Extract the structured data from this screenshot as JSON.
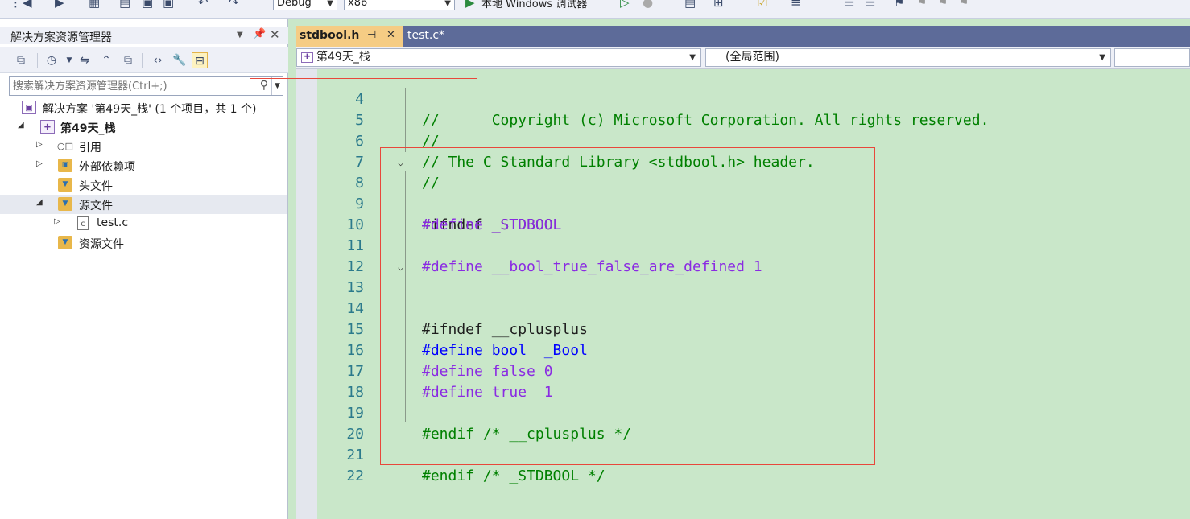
{
  "toolbar": {
    "config": "Debug",
    "platform": "x86",
    "debugger_label": "本地 Windows 调试器"
  },
  "solution_explorer": {
    "title": "解决方案资源管理器",
    "search_placeholder": "搜索解决方案资源管理器(Ctrl+;)",
    "tree": [
      {
        "label": "解决方案 '第49天_栈' (1 个项目，共 1 个)",
        "icon": "solution-icon",
        "level": 0,
        "arrow": ""
      },
      {
        "label": "第49天_栈",
        "icon": "project-icon",
        "level": 1,
        "arrow": "◢",
        "bold": true
      },
      {
        "label": "引用",
        "icon": "references-icon",
        "level": 2,
        "arrow": "▷"
      },
      {
        "label": "外部依赖项",
        "icon": "external-deps-icon",
        "level": 2,
        "arrow": "▷"
      },
      {
        "label": "头文件",
        "icon": "folder-filter-icon",
        "level": 2,
        "arrow": ""
      },
      {
        "label": "源文件",
        "icon": "folder-filter-icon",
        "level": 2,
        "arrow": "◢",
        "selected": true
      },
      {
        "label": "test.c",
        "icon": "c-file-icon",
        "level": 3,
        "arrow": "▷"
      },
      {
        "label": "资源文件",
        "icon": "folder-filter-icon",
        "level": 2,
        "arrow": ""
      }
    ]
  },
  "editor": {
    "tabs": [
      {
        "label": "stdbool.h",
        "active": true
      },
      {
        "label": "test.c*",
        "active": false
      }
    ],
    "nav_project": "第49天_栈",
    "nav_scope": "(全局范围)",
    "lines": [
      {
        "n": "4",
        "text": "//      Copyright (c) Microsoft Corporation. All rights reserved."
      },
      {
        "n": "5",
        "text": "//"
      },
      {
        "n": "6",
        "text": "// The C Standard Library <stdbool.h> header."
      },
      {
        "n": "7",
        "text": "//"
      },
      {
        "n": "8",
        "text": "#ifndef _STDBOOL"
      },
      {
        "n": "9",
        "text": "#define _STDBOOL"
      },
      {
        "n": "10",
        "text": ""
      },
      {
        "n": "11",
        "text": "#define __bool_true_false_are_defined 1"
      },
      {
        "n": "12",
        "text": ""
      },
      {
        "n": "13",
        "text": "#ifndef __cplusplus"
      },
      {
        "n": "14",
        "text": ""
      },
      {
        "n": "15",
        "text": "#define bool  _Bool"
      },
      {
        "n": "16",
        "text": "#define false 0"
      },
      {
        "n": "17",
        "text": "#define true  1"
      },
      {
        "n": "18",
        "text": ""
      },
      {
        "n": "19",
        "text": "#endif /* __cplusplus */"
      },
      {
        "n": "20",
        "text": ""
      },
      {
        "n": "21",
        "text": "#endif /* _STDBOOL */"
      },
      {
        "n": "22",
        "text": ""
      }
    ]
  },
  "colors": {
    "editor_bg": "#c9e7c9",
    "tab_active": "#f5cc84",
    "tab_strip": "#5d6b99",
    "annotation_box": "#e8473b",
    "comment": "#008000",
    "preprocessor": "#808080",
    "macro": "#8a2be2",
    "keyword": "#0000ff"
  }
}
